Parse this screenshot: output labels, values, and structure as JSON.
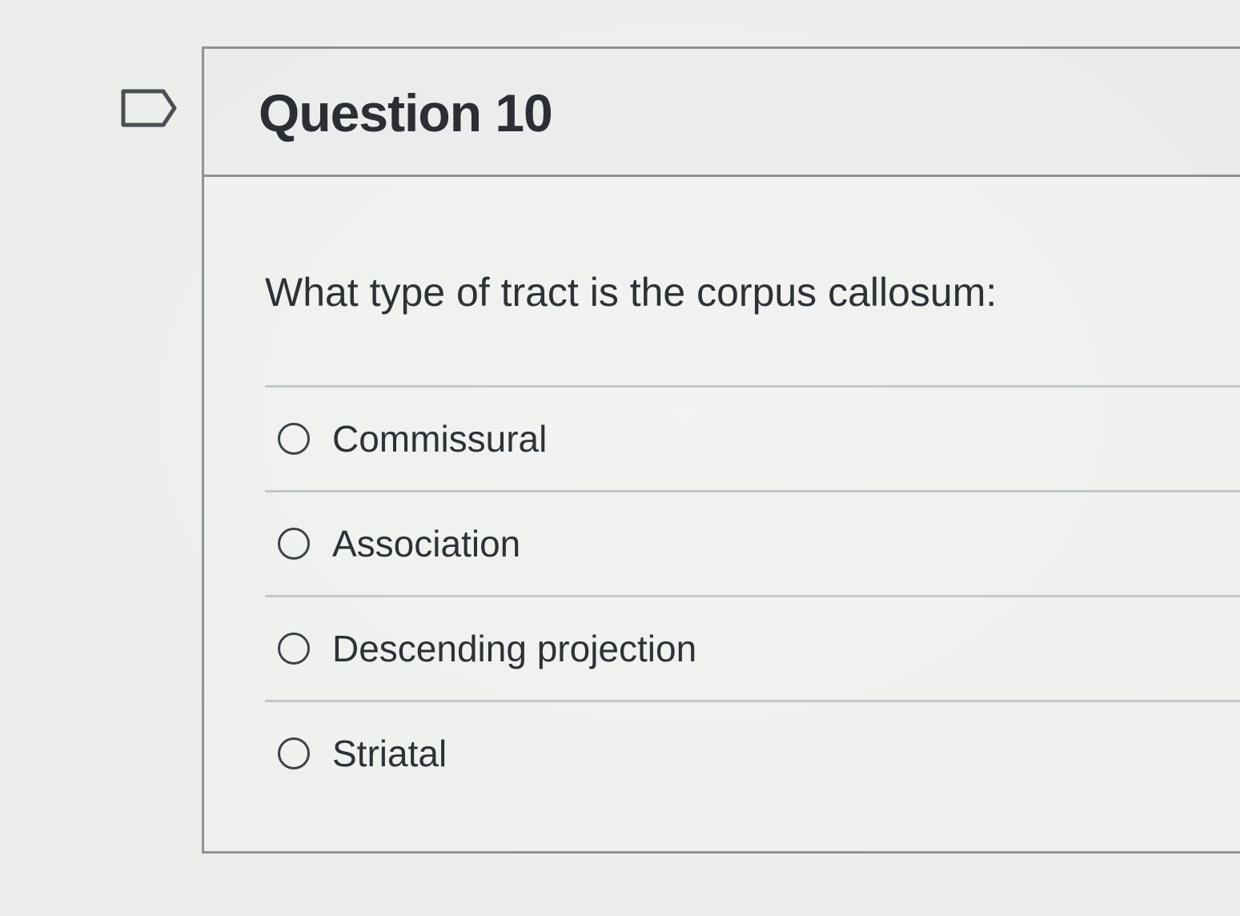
{
  "question": {
    "title": "Question 10",
    "flag_icon": "flag-question-icon",
    "prompt": "What type of tract is the corpus callosum:",
    "answers": [
      {
        "label": "Commissural",
        "selected": false
      },
      {
        "label": "Association",
        "selected": false
      },
      {
        "label": "Descending projection",
        "selected": false
      },
      {
        "label": "Striatal",
        "selected": false
      }
    ]
  }
}
